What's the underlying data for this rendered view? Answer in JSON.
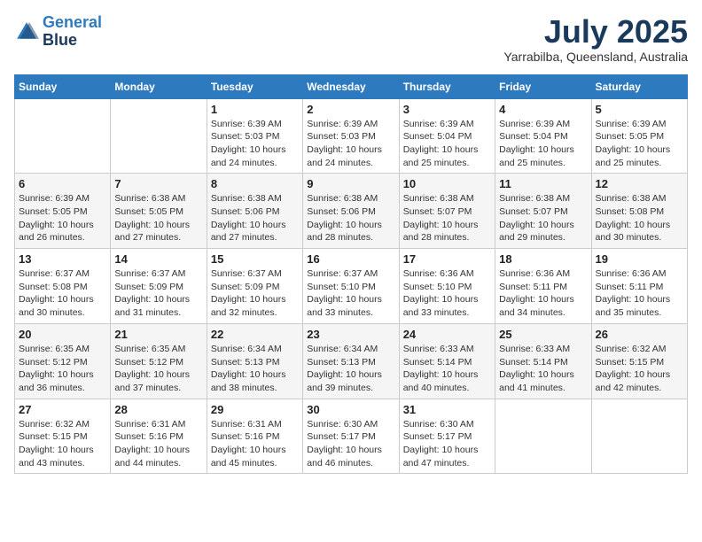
{
  "header": {
    "logo_line1": "General",
    "logo_line2": "Blue",
    "month_year": "July 2025",
    "location": "Yarrabilba, Queensland, Australia"
  },
  "days_of_week": [
    "Sunday",
    "Monday",
    "Tuesday",
    "Wednesday",
    "Thursday",
    "Friday",
    "Saturday"
  ],
  "weeks": [
    [
      {
        "day": "",
        "sunrise": "",
        "sunset": "",
        "daylight": ""
      },
      {
        "day": "",
        "sunrise": "",
        "sunset": "",
        "daylight": ""
      },
      {
        "day": "1",
        "sunrise": "Sunrise: 6:39 AM",
        "sunset": "Sunset: 5:03 PM",
        "daylight": "Daylight: 10 hours and 24 minutes."
      },
      {
        "day": "2",
        "sunrise": "Sunrise: 6:39 AM",
        "sunset": "Sunset: 5:03 PM",
        "daylight": "Daylight: 10 hours and 24 minutes."
      },
      {
        "day": "3",
        "sunrise": "Sunrise: 6:39 AM",
        "sunset": "Sunset: 5:04 PM",
        "daylight": "Daylight: 10 hours and 25 minutes."
      },
      {
        "day": "4",
        "sunrise": "Sunrise: 6:39 AM",
        "sunset": "Sunset: 5:04 PM",
        "daylight": "Daylight: 10 hours and 25 minutes."
      },
      {
        "day": "5",
        "sunrise": "Sunrise: 6:39 AM",
        "sunset": "Sunset: 5:05 PM",
        "daylight": "Daylight: 10 hours and 25 minutes."
      }
    ],
    [
      {
        "day": "6",
        "sunrise": "Sunrise: 6:39 AM",
        "sunset": "Sunset: 5:05 PM",
        "daylight": "Daylight: 10 hours and 26 minutes."
      },
      {
        "day": "7",
        "sunrise": "Sunrise: 6:38 AM",
        "sunset": "Sunset: 5:05 PM",
        "daylight": "Daylight: 10 hours and 27 minutes."
      },
      {
        "day": "8",
        "sunrise": "Sunrise: 6:38 AM",
        "sunset": "Sunset: 5:06 PM",
        "daylight": "Daylight: 10 hours and 27 minutes."
      },
      {
        "day": "9",
        "sunrise": "Sunrise: 6:38 AM",
        "sunset": "Sunset: 5:06 PM",
        "daylight": "Daylight: 10 hours and 28 minutes."
      },
      {
        "day": "10",
        "sunrise": "Sunrise: 6:38 AM",
        "sunset": "Sunset: 5:07 PM",
        "daylight": "Daylight: 10 hours and 28 minutes."
      },
      {
        "day": "11",
        "sunrise": "Sunrise: 6:38 AM",
        "sunset": "Sunset: 5:07 PM",
        "daylight": "Daylight: 10 hours and 29 minutes."
      },
      {
        "day": "12",
        "sunrise": "Sunrise: 6:38 AM",
        "sunset": "Sunset: 5:08 PM",
        "daylight": "Daylight: 10 hours and 30 minutes."
      }
    ],
    [
      {
        "day": "13",
        "sunrise": "Sunrise: 6:37 AM",
        "sunset": "Sunset: 5:08 PM",
        "daylight": "Daylight: 10 hours and 30 minutes."
      },
      {
        "day": "14",
        "sunrise": "Sunrise: 6:37 AM",
        "sunset": "Sunset: 5:09 PM",
        "daylight": "Daylight: 10 hours and 31 minutes."
      },
      {
        "day": "15",
        "sunrise": "Sunrise: 6:37 AM",
        "sunset": "Sunset: 5:09 PM",
        "daylight": "Daylight: 10 hours and 32 minutes."
      },
      {
        "day": "16",
        "sunrise": "Sunrise: 6:37 AM",
        "sunset": "Sunset: 5:10 PM",
        "daylight": "Daylight: 10 hours and 33 minutes."
      },
      {
        "day": "17",
        "sunrise": "Sunrise: 6:36 AM",
        "sunset": "Sunset: 5:10 PM",
        "daylight": "Daylight: 10 hours and 33 minutes."
      },
      {
        "day": "18",
        "sunrise": "Sunrise: 6:36 AM",
        "sunset": "Sunset: 5:11 PM",
        "daylight": "Daylight: 10 hours and 34 minutes."
      },
      {
        "day": "19",
        "sunrise": "Sunrise: 6:36 AM",
        "sunset": "Sunset: 5:11 PM",
        "daylight": "Daylight: 10 hours and 35 minutes."
      }
    ],
    [
      {
        "day": "20",
        "sunrise": "Sunrise: 6:35 AM",
        "sunset": "Sunset: 5:12 PM",
        "daylight": "Daylight: 10 hours and 36 minutes."
      },
      {
        "day": "21",
        "sunrise": "Sunrise: 6:35 AM",
        "sunset": "Sunset: 5:12 PM",
        "daylight": "Daylight: 10 hours and 37 minutes."
      },
      {
        "day": "22",
        "sunrise": "Sunrise: 6:34 AM",
        "sunset": "Sunset: 5:13 PM",
        "daylight": "Daylight: 10 hours and 38 minutes."
      },
      {
        "day": "23",
        "sunrise": "Sunrise: 6:34 AM",
        "sunset": "Sunset: 5:13 PM",
        "daylight": "Daylight: 10 hours and 39 minutes."
      },
      {
        "day": "24",
        "sunrise": "Sunrise: 6:33 AM",
        "sunset": "Sunset: 5:14 PM",
        "daylight": "Daylight: 10 hours and 40 minutes."
      },
      {
        "day": "25",
        "sunrise": "Sunrise: 6:33 AM",
        "sunset": "Sunset: 5:14 PM",
        "daylight": "Daylight: 10 hours and 41 minutes."
      },
      {
        "day": "26",
        "sunrise": "Sunrise: 6:32 AM",
        "sunset": "Sunset: 5:15 PM",
        "daylight": "Daylight: 10 hours and 42 minutes."
      }
    ],
    [
      {
        "day": "27",
        "sunrise": "Sunrise: 6:32 AM",
        "sunset": "Sunset: 5:15 PM",
        "daylight": "Daylight: 10 hours and 43 minutes."
      },
      {
        "day": "28",
        "sunrise": "Sunrise: 6:31 AM",
        "sunset": "Sunset: 5:16 PM",
        "daylight": "Daylight: 10 hours and 44 minutes."
      },
      {
        "day": "29",
        "sunrise": "Sunrise: 6:31 AM",
        "sunset": "Sunset: 5:16 PM",
        "daylight": "Daylight: 10 hours and 45 minutes."
      },
      {
        "day": "30",
        "sunrise": "Sunrise: 6:30 AM",
        "sunset": "Sunset: 5:17 PM",
        "daylight": "Daylight: 10 hours and 46 minutes."
      },
      {
        "day": "31",
        "sunrise": "Sunrise: 6:30 AM",
        "sunset": "Sunset: 5:17 PM",
        "daylight": "Daylight: 10 hours and 47 minutes."
      },
      {
        "day": "",
        "sunrise": "",
        "sunset": "",
        "daylight": ""
      },
      {
        "day": "",
        "sunrise": "",
        "sunset": "",
        "daylight": ""
      }
    ]
  ]
}
